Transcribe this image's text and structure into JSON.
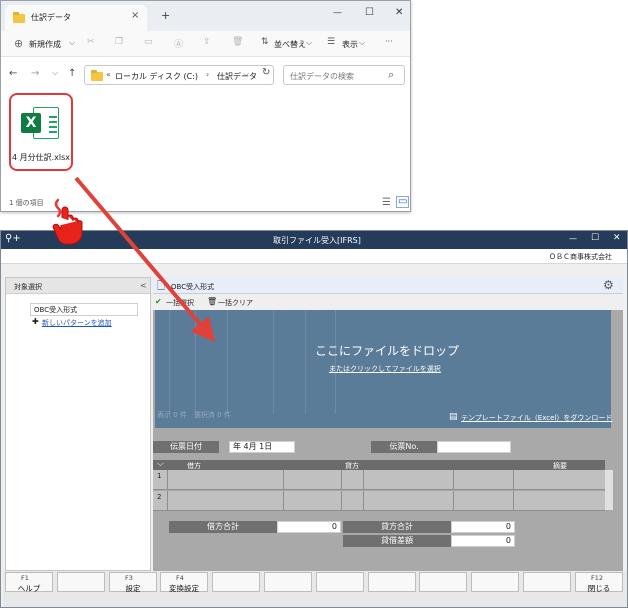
{
  "explorer": {
    "tab_title": "仕訳データ",
    "tab_close": "×",
    "new_tab": "+",
    "win_min": "—",
    "win_max": "☐",
    "win_close": "✕",
    "toolbar": {
      "new_label": "新規作成",
      "new_chevron": "⌵",
      "sort_label": "並べ替え",
      "sort_chevron": "⌵",
      "view_label": "表示",
      "view_chevron": "⌵",
      "more": "···"
    },
    "nav": {
      "back": "←",
      "forward": "→",
      "dropdown": "⌵",
      "up": "↑"
    },
    "breadcrumb": {
      "overflow": "«",
      "drive": "ローカル ディスク (C:)",
      "separator": "›",
      "folder": "仕訳データ"
    },
    "address_chevron": "⌵",
    "refresh": "↻",
    "search_placeholder": "仕訳データの検索",
    "search_icon": "⌕",
    "file": {
      "name": "4 月分仕訳.xlsx",
      "icon_letter": "X"
    },
    "status": "1 個の項目"
  },
  "app": {
    "title": "取引ファイル受入[IFRS]",
    "win_min": "—",
    "win_max": "☐",
    "win_close": "✕",
    "company": "ＯＢＣ商事株式会社",
    "left_panel": {
      "header": "対象選択",
      "collapse": "<",
      "pattern": "OBC受入形式",
      "add_icon": "✚",
      "add_pattern_link": "新しいパターンを追加"
    },
    "main": {
      "format_title": "OBC受入形式",
      "select_all": "一括選択",
      "clear_all": "一括クリア",
      "ghost_count": "表示 0 件　選択済 0 件",
      "drop_title": "ここにファイルをドロップ",
      "drop_link": "またはクリックしてファイルを選択",
      "template_download": "テンプレートファイル（Excel）をダウンロード",
      "voucher_date_label": "伝票日付",
      "voucher_date_value": "年  4月  1日",
      "voucher_no_label": "伝票No.",
      "grid": {
        "collapse": "⌵",
        "debit": "借方",
        "credit": "貸方",
        "memo": "摘要",
        "rows": [
          "1",
          "2"
        ]
      },
      "debit_total_label": "借方合計",
      "debit_total": "0",
      "credit_total_label": "貸方合計",
      "credit_total": "0",
      "difference_label": "貸借差額",
      "difference": "0"
    },
    "fkeys": [
      {
        "key": "F1",
        "label": "ヘルプ"
      },
      {
        "key": "",
        "label": ""
      },
      {
        "key": "F3",
        "label": "設定"
      },
      {
        "key": "F4",
        "label": "変換設定"
      },
      {
        "key": "",
        "label": ""
      },
      {
        "key": "",
        "label": ""
      },
      {
        "key": "",
        "label": ""
      },
      {
        "key": "",
        "label": ""
      },
      {
        "key": "",
        "label": ""
      },
      {
        "key": "",
        "label": ""
      },
      {
        "key": "",
        "label": ""
      },
      {
        "key": "F12",
        "label": "閉じる"
      }
    ]
  },
  "colors": {
    "highlight": "#e23a3a",
    "app_title_bg": "#243b5a",
    "drop_zone": "#5a7c99",
    "excel_green": "#107c41"
  }
}
